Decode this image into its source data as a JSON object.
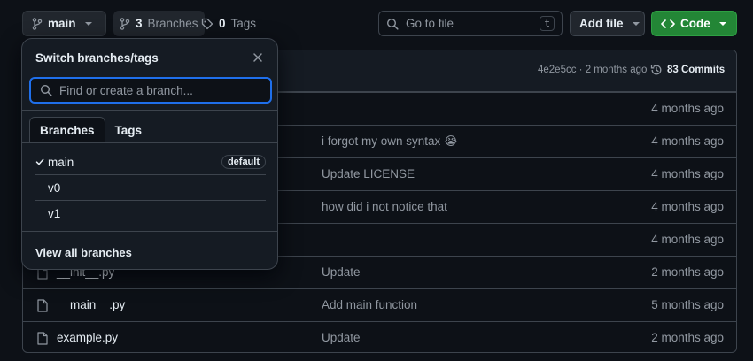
{
  "toolbar": {
    "branch_button": "main",
    "branches_count": "3",
    "branches_label": "Branches",
    "tags_count": "0",
    "tags_label": "Tags",
    "goto_placeholder": "Go to file",
    "goto_shortcut": "t",
    "add_file_label": "Add file",
    "code_label": "Code"
  },
  "latest_commit": {
    "meta": "4e2e5cc · 2 months ago",
    "commits_label": "83 Commits"
  },
  "files": [
    {
      "name": "",
      "message": "",
      "time": "4 months ago"
    },
    {
      "name": "",
      "message": "i forgot my own syntax 😭",
      "time": "4 months ago"
    },
    {
      "name": "",
      "message": "Update LICENSE",
      "time": "4 months ago"
    },
    {
      "name": "",
      "message": "how did i not notice that",
      "time": "4 months ago"
    },
    {
      "name": "",
      "message": "",
      "time": "4 months ago"
    },
    {
      "name": "__init__.py",
      "message": "Update",
      "time": "2 months ago"
    },
    {
      "name": "__main__.py",
      "message": "Add main function",
      "time": "5 months ago"
    },
    {
      "name": "example.py",
      "message": "Update",
      "time": "2 months ago"
    }
  ],
  "branch_dropdown": {
    "title": "Switch branches/tags",
    "search_placeholder": "Find or create a branch...",
    "tabs": [
      "Branches",
      "Tags"
    ],
    "branches": [
      {
        "name": "main",
        "badge": "default",
        "selected": true
      },
      {
        "name": "v0",
        "badge": "",
        "selected": false
      },
      {
        "name": "v1",
        "badge": "",
        "selected": false
      }
    ],
    "view_all": "View all branches"
  },
  "colors": {
    "background": "#0d1117",
    "accent_blue": "#1f6feb",
    "code_green": "#238636"
  },
  "icons": [
    "branch-icon",
    "tag-icon",
    "search-icon",
    "close-icon",
    "check-icon",
    "file-icon",
    "history-icon",
    "code-icon"
  ]
}
